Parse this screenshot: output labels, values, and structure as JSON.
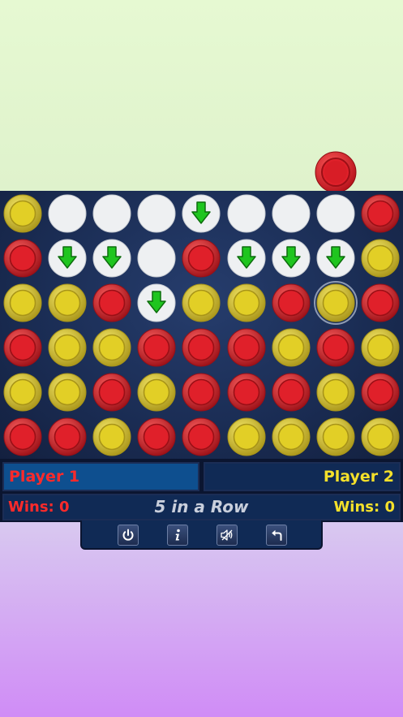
{
  "players": {
    "p1": {
      "name": "Player 1",
      "wins": "Wins: 0"
    },
    "p2": {
      "name": "Player 2",
      "wins": "Wins: 0"
    }
  },
  "game_mode": "5 in a Row",
  "pending_piece": {
    "color": "red",
    "column": 7
  },
  "board": {
    "columns": 9,
    "rows": 6,
    "grid": [
      [
        "Y",
        "E",
        "E",
        "E",
        "A",
        "E",
        "E",
        "E",
        "R"
      ],
      [
        "R",
        "A",
        "A",
        "E",
        "R",
        "A",
        "A",
        "A",
        "Y"
      ],
      [
        "Y",
        "Y",
        "R",
        "A",
        "Y",
        "Y",
        "R",
        "Y",
        "R"
      ],
      [
        "R",
        "Y",
        "Y",
        "R",
        "R",
        "R",
        "Y",
        "R",
        "Y"
      ],
      [
        "Y",
        "Y",
        "R",
        "Y",
        "R",
        "R",
        "R",
        "Y",
        "R"
      ],
      [
        "R",
        "R",
        "Y",
        "R",
        "R",
        "Y",
        "Y",
        "Y",
        "Y"
      ]
    ],
    "legend": {
      "R": "red piece",
      "Y": "yellow piece",
      "E": "empty",
      "A": "empty drop target"
    },
    "highlighted_cell": {
      "row": 2,
      "col": 7
    }
  },
  "toolbar": [
    {
      "name": "power-button",
      "icon": "power-icon"
    },
    {
      "name": "info-button",
      "icon": "info-icon"
    },
    {
      "name": "sound-button",
      "icon": "speaker-icon"
    },
    {
      "name": "undo-button",
      "icon": "undo-arrow-icon"
    }
  ],
  "colors": {
    "red": "#e0202a",
    "yellow": "#e2cf26",
    "empty": "#eef0f2",
    "arrow": "#1fc51f",
    "p1_text": "#ff2a2a",
    "p2_text": "#f4e02a"
  }
}
